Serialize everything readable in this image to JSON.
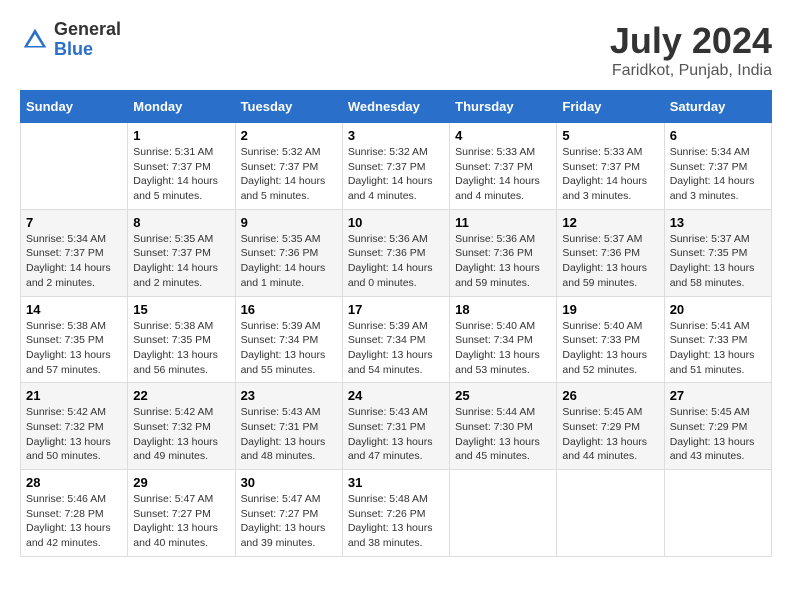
{
  "logo": {
    "general": "General",
    "blue": "Blue"
  },
  "title": "July 2024",
  "location": "Faridkot, Punjab, India",
  "days_of_week": [
    "Sunday",
    "Monday",
    "Tuesday",
    "Wednesday",
    "Thursday",
    "Friday",
    "Saturday"
  ],
  "weeks": [
    [
      {
        "day": "",
        "info": ""
      },
      {
        "day": "1",
        "info": "Sunrise: 5:31 AM\nSunset: 7:37 PM\nDaylight: 14 hours\nand 5 minutes."
      },
      {
        "day": "2",
        "info": "Sunrise: 5:32 AM\nSunset: 7:37 PM\nDaylight: 14 hours\nand 5 minutes."
      },
      {
        "day": "3",
        "info": "Sunrise: 5:32 AM\nSunset: 7:37 PM\nDaylight: 14 hours\nand 4 minutes."
      },
      {
        "day": "4",
        "info": "Sunrise: 5:33 AM\nSunset: 7:37 PM\nDaylight: 14 hours\nand 4 minutes."
      },
      {
        "day": "5",
        "info": "Sunrise: 5:33 AM\nSunset: 7:37 PM\nDaylight: 14 hours\nand 3 minutes."
      },
      {
        "day": "6",
        "info": "Sunrise: 5:34 AM\nSunset: 7:37 PM\nDaylight: 14 hours\nand 3 minutes."
      }
    ],
    [
      {
        "day": "7",
        "info": "Sunrise: 5:34 AM\nSunset: 7:37 PM\nDaylight: 14 hours\nand 2 minutes."
      },
      {
        "day": "8",
        "info": "Sunrise: 5:35 AM\nSunset: 7:37 PM\nDaylight: 14 hours\nand 2 minutes."
      },
      {
        "day": "9",
        "info": "Sunrise: 5:35 AM\nSunset: 7:36 PM\nDaylight: 14 hours\nand 1 minute."
      },
      {
        "day": "10",
        "info": "Sunrise: 5:36 AM\nSunset: 7:36 PM\nDaylight: 14 hours\nand 0 minutes."
      },
      {
        "day": "11",
        "info": "Sunrise: 5:36 AM\nSunset: 7:36 PM\nDaylight: 13 hours\nand 59 minutes."
      },
      {
        "day": "12",
        "info": "Sunrise: 5:37 AM\nSunset: 7:36 PM\nDaylight: 13 hours\nand 59 minutes."
      },
      {
        "day": "13",
        "info": "Sunrise: 5:37 AM\nSunset: 7:35 PM\nDaylight: 13 hours\nand 58 minutes."
      }
    ],
    [
      {
        "day": "14",
        "info": "Sunrise: 5:38 AM\nSunset: 7:35 PM\nDaylight: 13 hours\nand 57 minutes."
      },
      {
        "day": "15",
        "info": "Sunrise: 5:38 AM\nSunset: 7:35 PM\nDaylight: 13 hours\nand 56 minutes."
      },
      {
        "day": "16",
        "info": "Sunrise: 5:39 AM\nSunset: 7:34 PM\nDaylight: 13 hours\nand 55 minutes."
      },
      {
        "day": "17",
        "info": "Sunrise: 5:39 AM\nSunset: 7:34 PM\nDaylight: 13 hours\nand 54 minutes."
      },
      {
        "day": "18",
        "info": "Sunrise: 5:40 AM\nSunset: 7:34 PM\nDaylight: 13 hours\nand 53 minutes."
      },
      {
        "day": "19",
        "info": "Sunrise: 5:40 AM\nSunset: 7:33 PM\nDaylight: 13 hours\nand 52 minutes."
      },
      {
        "day": "20",
        "info": "Sunrise: 5:41 AM\nSunset: 7:33 PM\nDaylight: 13 hours\nand 51 minutes."
      }
    ],
    [
      {
        "day": "21",
        "info": "Sunrise: 5:42 AM\nSunset: 7:32 PM\nDaylight: 13 hours\nand 50 minutes."
      },
      {
        "day": "22",
        "info": "Sunrise: 5:42 AM\nSunset: 7:32 PM\nDaylight: 13 hours\nand 49 minutes."
      },
      {
        "day": "23",
        "info": "Sunrise: 5:43 AM\nSunset: 7:31 PM\nDaylight: 13 hours\nand 48 minutes."
      },
      {
        "day": "24",
        "info": "Sunrise: 5:43 AM\nSunset: 7:31 PM\nDaylight: 13 hours\nand 47 minutes."
      },
      {
        "day": "25",
        "info": "Sunrise: 5:44 AM\nSunset: 7:30 PM\nDaylight: 13 hours\nand 45 minutes."
      },
      {
        "day": "26",
        "info": "Sunrise: 5:45 AM\nSunset: 7:29 PM\nDaylight: 13 hours\nand 44 minutes."
      },
      {
        "day": "27",
        "info": "Sunrise: 5:45 AM\nSunset: 7:29 PM\nDaylight: 13 hours\nand 43 minutes."
      }
    ],
    [
      {
        "day": "28",
        "info": "Sunrise: 5:46 AM\nSunset: 7:28 PM\nDaylight: 13 hours\nand 42 minutes."
      },
      {
        "day": "29",
        "info": "Sunrise: 5:47 AM\nSunset: 7:27 PM\nDaylight: 13 hours\nand 40 minutes."
      },
      {
        "day": "30",
        "info": "Sunrise: 5:47 AM\nSunset: 7:27 PM\nDaylight: 13 hours\nand 39 minutes."
      },
      {
        "day": "31",
        "info": "Sunrise: 5:48 AM\nSunset: 7:26 PM\nDaylight: 13 hours\nand 38 minutes."
      },
      {
        "day": "",
        "info": ""
      },
      {
        "day": "",
        "info": ""
      },
      {
        "day": "",
        "info": ""
      }
    ]
  ]
}
